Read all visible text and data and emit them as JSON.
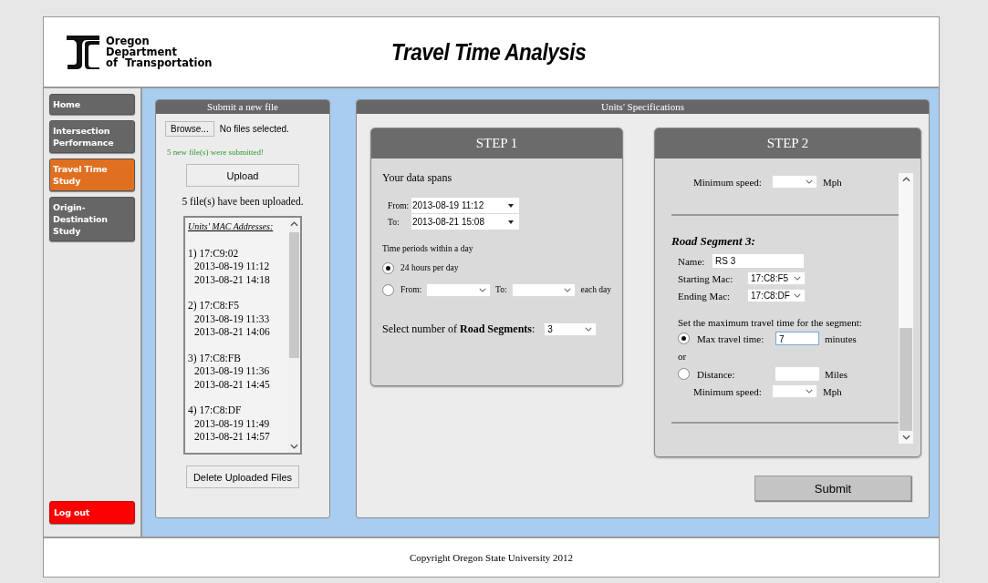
{
  "header": {
    "org_lines": [
      "Oregon",
      "Department",
      "of  Transportation"
    ],
    "title": "Travel Time Analysis"
  },
  "sidebar": {
    "items": [
      {
        "label": "Home",
        "selected": false
      },
      {
        "label": "Intersection Performance",
        "selected": false
      },
      {
        "label": "Travel Time Study",
        "selected": true
      },
      {
        "label": "Origin-Destination Study",
        "selected": false
      }
    ],
    "logout": "Log out"
  },
  "upload_panel": {
    "title": "Submit a new file",
    "browse_button": "Browse...",
    "file_status": "No files selected.",
    "message": "5 new file(s) were submitted!",
    "upload_button": "Upload",
    "count_text": "5 file(s) have been uploaded.",
    "mac_list": {
      "heading": "Units' MAC Addresses:",
      "units": [
        {
          "label": "1) 17:C9:02",
          "start": "2013-08-19 11:12",
          "end": "2013-08-21 14:18"
        },
        {
          "label": "2) 17:C8:F5",
          "start": "2013-08-19 11:33",
          "end": "2013-08-21 14:06"
        },
        {
          "label": "3) 17:C8:FB",
          "start": "2013-08-19 11:36",
          "end": "2013-08-21 14:45"
        },
        {
          "label": "4) 17:C8:DF",
          "start": "2013-08-19 11:49",
          "end": "2013-08-21 14:57"
        }
      ]
    },
    "delete_button": "Delete Uploaded Files"
  },
  "specs_panel": {
    "title": "Units' Specifications",
    "step1": {
      "title": "STEP 1",
      "spans_label": "Your data spans",
      "from_label": "From:",
      "from_value": "2013-08-19 11:12",
      "to_label": "To:",
      "to_value": "2013-08-21 15:08",
      "periods_label": "Time periods within a day",
      "options": [
        {
          "kind": "full",
          "label": "24 hours per day",
          "selected": true
        },
        {
          "kind": "range",
          "label": "From:",
          "to_label": "To:",
          "suffix": "each day",
          "selected": false
        }
      ],
      "segments_label": "Select number of **Road Segments**:",
      "segments_value": "3"
    },
    "step2": {
      "title": "STEP 2",
      "top_speed_label": "Minimum speed:",
      "top_speed_unit": "Mph",
      "segment_title": "Road Segment 3:",
      "name_label": "Name:",
      "name_value": "RS 3",
      "start_label": "Starting Mac:",
      "start_value": "17:C8:F5",
      "end_label": "Ending Mac:",
      "end_value": "17:C8:DF",
      "prompt": "Set the maximum travel time for the segment:",
      "options": [
        {
          "kind": "time",
          "label": "Max travel time:",
          "value": "7",
          "unit": "minutes",
          "selected": true
        },
        {
          "kind": "distance",
          "label": "Distance:",
          "unit": "Miles",
          "selected": false
        }
      ],
      "or_text": "or",
      "speed_label": "Minimum speed:",
      "speed_unit": "Mph"
    },
    "submit_button": "Submit"
  },
  "footer": "Copyright Oregon State University 2012"
}
